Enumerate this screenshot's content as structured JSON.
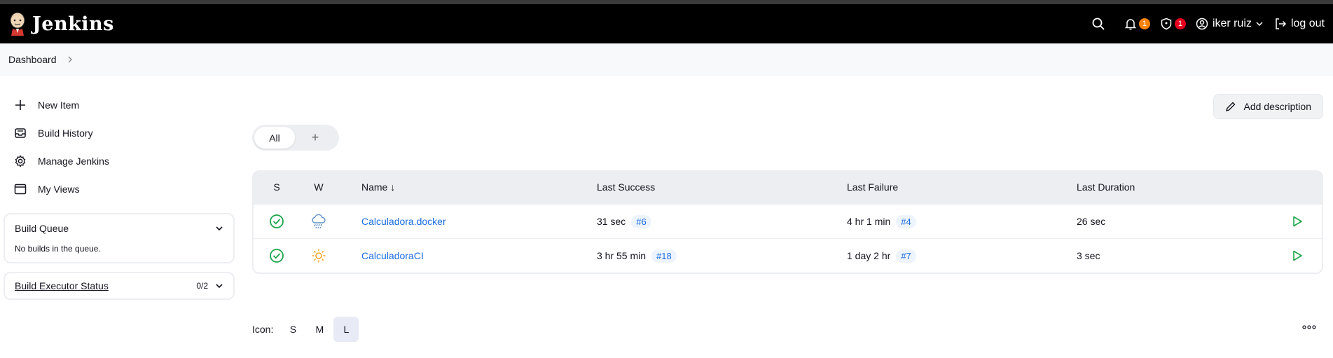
{
  "header": {
    "app_name": "Jenkins",
    "notifications_count": "1",
    "security_count": "1",
    "user_name": "iker ruiz",
    "logout_label": "log out"
  },
  "breadcrumb": {
    "dashboard": "Dashboard"
  },
  "sidebar": {
    "tasks": [
      {
        "label": "New Item",
        "icon": "plus-icon"
      },
      {
        "label": "Build History",
        "icon": "inbox-icon"
      },
      {
        "label": "Manage Jenkins",
        "icon": "gear-icon"
      },
      {
        "label": "My Views",
        "icon": "window-icon"
      }
    ],
    "build_queue": {
      "title": "Build Queue",
      "empty_text": "No builds in the queue."
    },
    "executor_status": {
      "title": "Build Executor Status",
      "count": "0/2"
    }
  },
  "content": {
    "add_description": "Add description",
    "tabs": {
      "all": "All",
      "add": "+"
    },
    "table": {
      "headers": {
        "s": "S",
        "w": "W",
        "name": "Name",
        "name_sort": "↓",
        "last_success": "Last Success",
        "last_failure": "Last Failure",
        "last_duration": "Last Duration"
      },
      "rows": [
        {
          "status": "success",
          "weather": "rain-icon",
          "name": "Calculadora.docker",
          "last_success": "31 sec",
          "last_success_build": "#6",
          "last_failure": "4 hr 1 min",
          "last_failure_build": "#4",
          "last_duration": "26 sec"
        },
        {
          "status": "success",
          "weather": "sun-icon",
          "name": "CalculadoraCI",
          "last_success": "3 hr 55 min",
          "last_success_build": "#18",
          "last_failure": "1 day 2 hr",
          "last_failure_build": "#7",
          "last_duration": "3 sec"
        }
      ]
    },
    "icon_size": {
      "label": "Icon:",
      "options": [
        "S",
        "M",
        "L"
      ],
      "selected": "L"
    }
  },
  "colors": {
    "success": "#1ea64b",
    "link": "#1a6ce0",
    "sun": "#f5a623",
    "rain": "#5d8fc9"
  }
}
